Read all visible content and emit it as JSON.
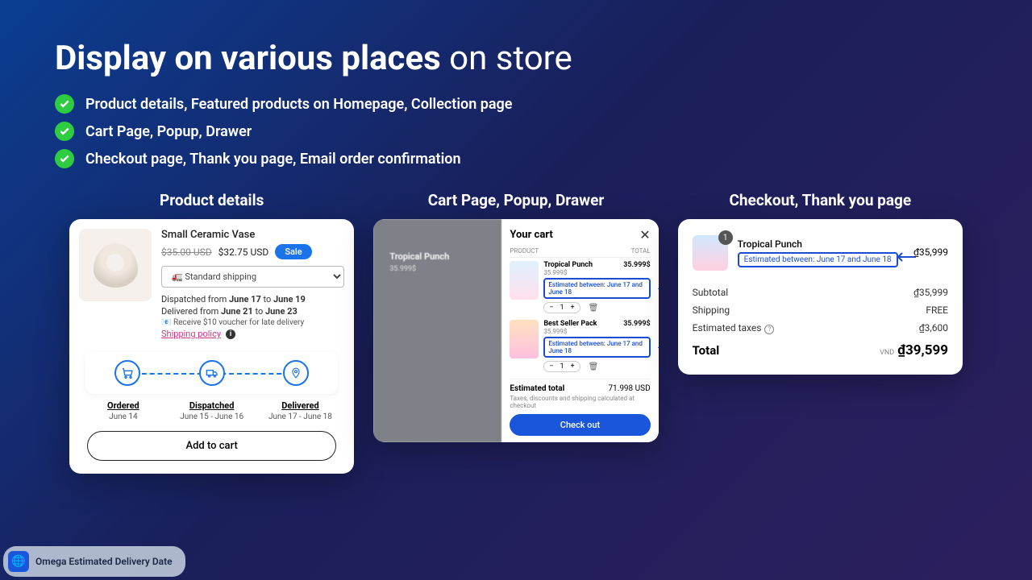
{
  "headline": {
    "bold": "Display on various places",
    "light": "on store"
  },
  "features": [
    "Product details, Featured products on Homepage, Collection page",
    "Cart Page, Popup, Drawer",
    "Checkout page, Thank you page, Email order confirmation"
  ],
  "columns": {
    "product": {
      "title": "Product details",
      "name": "Small Ceramic Vase",
      "old_price": "$35.00 USD",
      "new_price": "$32.75 USD",
      "sale": "Sale",
      "shipping_option": "🚛 Standard shipping",
      "dispatched": {
        "prefix": "Dispatched from ",
        "from": "June 17",
        "mid": " to ",
        "to": "June 19"
      },
      "delivered": {
        "prefix": "Delivered from ",
        "from": "June 21",
        "mid": " to ",
        "to": "June 23"
      },
      "voucher": "Receive $10 voucher for late delivery",
      "policy": "Shipping policy",
      "timeline": {
        "ordered": {
          "label": "Ordered",
          "date": "June 14"
        },
        "dispatched": {
          "label": "Dispatched",
          "date": "June 15 - June 16"
        },
        "delivered": {
          "label": "Delivered",
          "date": "June 17 - June 18"
        }
      },
      "add_to_cart": "Add to cart"
    },
    "cart": {
      "title": "Cart Page, Popup, Drawer",
      "bg_product": "Tropical Punch",
      "bg_price": "35.999$",
      "drawer_title": "Your cart",
      "col_product": "PRODUCT",
      "col_total": "TOTAL",
      "items": [
        {
          "name": "Tropical Punch",
          "sub": "35.999$",
          "price": "35.999$",
          "est": "Estimated between: June 17 and June 18",
          "qty": "1"
        },
        {
          "name": "Best Seller Pack",
          "sub": "35.999$",
          "price": "35.999$",
          "est": "Estimated between: June 17 and June 18",
          "qty": "1"
        }
      ],
      "est_total_label": "Estimated total",
      "est_total_value": "71.998 USD",
      "tax_note": "Taxes, discounts and shipping calculated at checkout",
      "checkout": "Check out"
    },
    "checkout": {
      "title": "Checkout, Thank you page",
      "badge": "1",
      "name": "Tropical Punch",
      "est": "Estimated between: June 17 and June 18",
      "price": "₫35,999",
      "summary": {
        "subtotal_label": "Subtotal",
        "subtotal": "₫35,999",
        "shipping_label": "Shipping",
        "shipping": "FREE",
        "tax_label": "Estimated taxes",
        "tax": "₫3,600",
        "total_label": "Total",
        "currency": "VND",
        "total": "₫39,599"
      }
    }
  },
  "footer": {
    "app": "Omega Estimated Delivery Date"
  }
}
